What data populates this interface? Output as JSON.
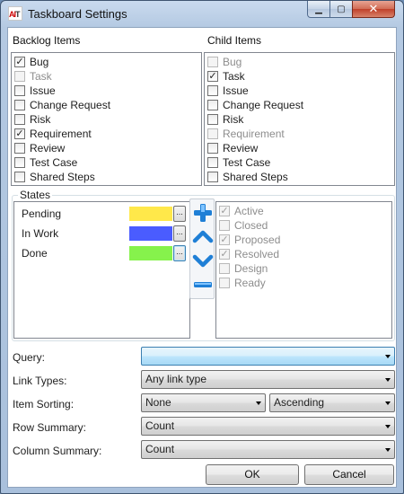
{
  "window": {
    "title": "Taskboard Settings",
    "icon_text_red": "AI",
    "icon_text_dark": "T",
    "minimize_glyph": "▁",
    "maximize_glyph": "▢",
    "close_glyph": "✕"
  },
  "backlog": {
    "header": "Backlog Items",
    "items": [
      {
        "label": "Bug",
        "checked": true,
        "enabled": true
      },
      {
        "label": "Task",
        "checked": false,
        "enabled": false
      },
      {
        "label": "Issue",
        "checked": false,
        "enabled": true
      },
      {
        "label": "Change Request",
        "checked": false,
        "enabled": true
      },
      {
        "label": "Risk",
        "checked": false,
        "enabled": true
      },
      {
        "label": "Requirement",
        "checked": true,
        "enabled": true
      },
      {
        "label": "Review",
        "checked": false,
        "enabled": true
      },
      {
        "label": "Test Case",
        "checked": false,
        "enabled": true
      },
      {
        "label": "Shared Steps",
        "checked": false,
        "enabled": true
      }
    ]
  },
  "child": {
    "header": "Child Items",
    "items": [
      {
        "label": "Bug",
        "checked": false,
        "enabled": false
      },
      {
        "label": "Task",
        "checked": true,
        "enabled": true
      },
      {
        "label": "Issue",
        "checked": false,
        "enabled": true
      },
      {
        "label": "Change Request",
        "checked": false,
        "enabled": true
      },
      {
        "label": "Risk",
        "checked": false,
        "enabled": true
      },
      {
        "label": "Requirement",
        "checked": false,
        "enabled": false
      },
      {
        "label": "Review",
        "checked": false,
        "enabled": true
      },
      {
        "label": "Test Case",
        "checked": false,
        "enabled": true
      },
      {
        "label": "Shared Steps",
        "checked": false,
        "enabled": true
      }
    ]
  },
  "states": {
    "header": "States",
    "ellipsis": "...",
    "items": [
      {
        "label": "Pending",
        "color": "#ffe84a"
      },
      {
        "label": "In Work",
        "color": "#4a5cff"
      },
      {
        "label": "Done",
        "color": "#86f24c"
      }
    ],
    "tools": [
      {
        "name": "add-state-icon"
      },
      {
        "name": "move-up-icon"
      },
      {
        "name": "move-down-icon"
      },
      {
        "name": "remove-state-icon"
      }
    ],
    "available": [
      {
        "label": "Active",
        "checked": true
      },
      {
        "label": "Closed",
        "checked": false
      },
      {
        "label": "Proposed",
        "checked": true
      },
      {
        "label": "Resolved",
        "checked": true
      },
      {
        "label": "Design",
        "checked": false
      },
      {
        "label": "Ready",
        "checked": false
      }
    ]
  },
  "form": {
    "query_label": "Query:",
    "query_value": "",
    "link_types_label": "Link Types:",
    "link_types_value": "Any link type",
    "item_sorting_label": "Item Sorting:",
    "sorting_field_value": "None",
    "sorting_direction_value": "Ascending",
    "row_summary_label": "Row Summary:",
    "row_summary_value": "Count",
    "column_summary_label": "Column Summary:",
    "column_summary_value": "Count"
  },
  "buttons": {
    "ok": "OK",
    "cancel": "Cancel"
  },
  "colors": {
    "accent": "#1f7fd6",
    "selection": "#3c7fb1"
  }
}
